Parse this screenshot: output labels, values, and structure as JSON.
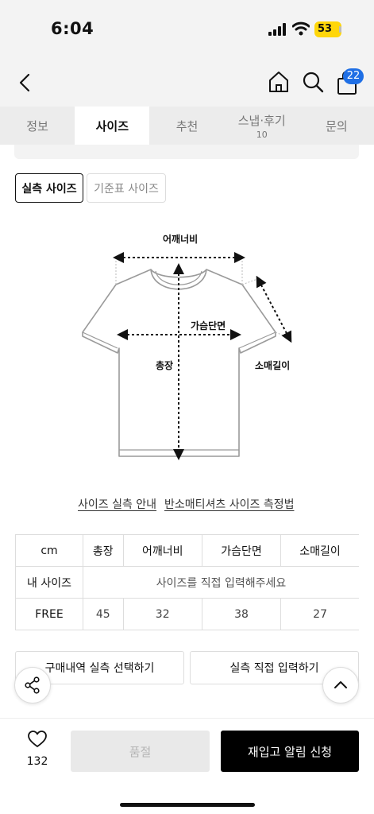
{
  "status": {
    "time": "6:04",
    "battery": "53"
  },
  "cart": {
    "badge": "22"
  },
  "tabs": [
    {
      "label": "정보",
      "sub": ""
    },
    {
      "label": "사이즈",
      "sub": ""
    },
    {
      "label": "추천",
      "sub": ""
    },
    {
      "label": "스냅·후기",
      "sub": "10"
    },
    {
      "label": "문의",
      "sub": ""
    }
  ],
  "size_toggle": {
    "actual": "실측 사이즈",
    "standard": "기준표 사이즈"
  },
  "diagram": {
    "shoulder": "어깨너비",
    "chest": "가슴단면",
    "length": "총장",
    "sleeve": "소매길이"
  },
  "links": {
    "guide": "사이즈 실측 안내",
    "measure": "반소매티셔츠 사이즈 측정법"
  },
  "table": {
    "unit": "cm",
    "headers": [
      "총장",
      "어깨너비",
      "가슴단면",
      "소매길이"
    ],
    "my_size_label": "내 사이즈",
    "my_size_hint": "사이즈를 직접 입력해주세요",
    "rows": [
      {
        "size": "FREE",
        "values": [
          "45",
          "32",
          "38",
          "27"
        ]
      }
    ]
  },
  "actions": {
    "purchase_select": "구매내역 실측 선택하기",
    "direct_input": "실측 직접 입력하기"
  },
  "bottom": {
    "likes": "132",
    "soldout": "품절",
    "restock": "재입고 알림 신청"
  },
  "colors": {
    "accent_badge": "#1f6fe5",
    "battery": "#ffd60a",
    "primary_button": "#000000"
  }
}
